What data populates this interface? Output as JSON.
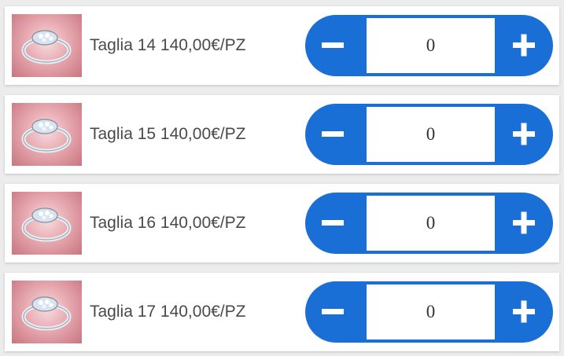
{
  "items": [
    {
      "label": "Taglia 14 140,00€/PZ",
      "quantity": "0"
    },
    {
      "label": "Taglia 15 140,00€/PZ",
      "quantity": "0"
    },
    {
      "label": "Taglia 16 140,00€/PZ",
      "quantity": "0"
    },
    {
      "label": "Taglia 17 140,00€/PZ",
      "quantity": "0"
    }
  ],
  "icons": {
    "product": "ring-image",
    "decrement": "minus-icon",
    "increment": "plus-icon"
  },
  "colors": {
    "accent": "#1a6fd6",
    "text": "#4a4a4a",
    "background": "#ececec"
  }
}
